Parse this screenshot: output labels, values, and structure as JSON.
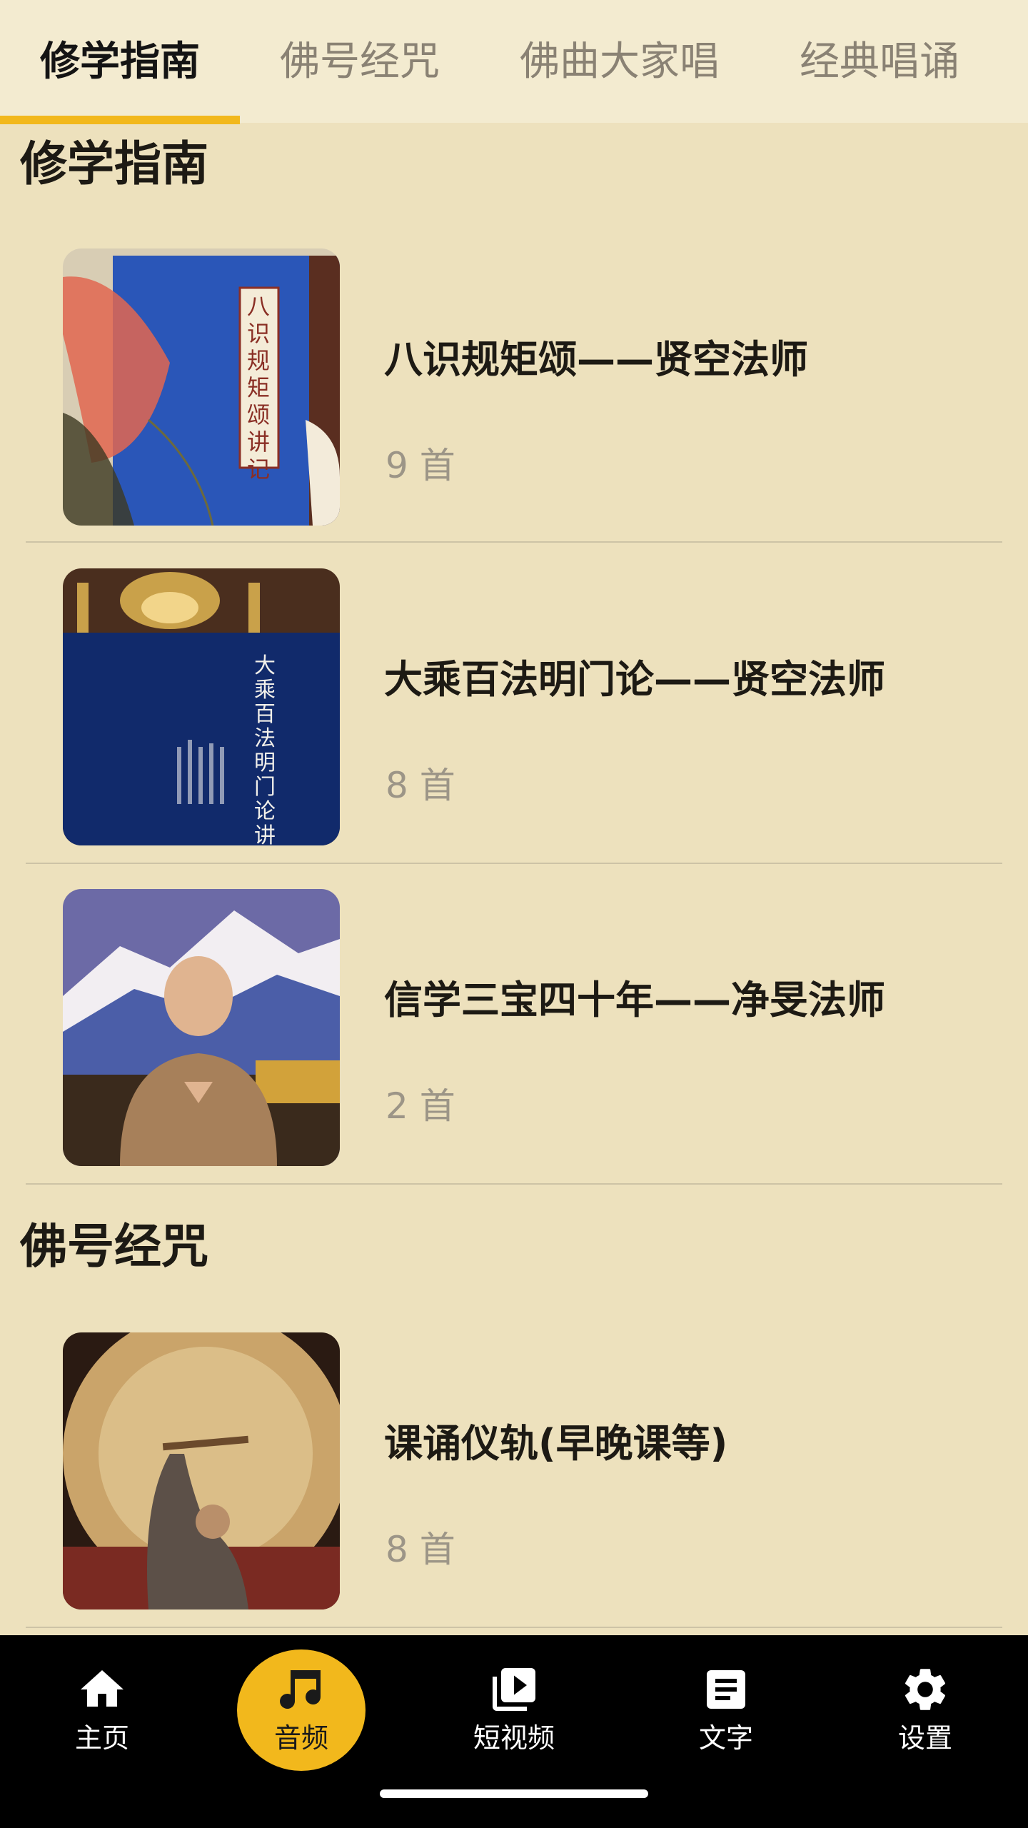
{
  "tabs": [
    {
      "label": "修学指南",
      "active": true
    },
    {
      "label": "佛号经咒",
      "active": false
    },
    {
      "label": "佛曲大家唱",
      "active": false
    },
    {
      "label": "经典唱诵",
      "active": false
    }
  ],
  "sections": [
    {
      "title": "修学指南",
      "items": [
        {
          "title": "八识规矩颂——贤空法师",
          "count": "9 首",
          "cover_text": "八识规矩颂讲记"
        },
        {
          "title": "大乘百法明门论——贤空法师",
          "count": "8 首",
          "cover_text": "大乘百法明门论讲记"
        },
        {
          "title": "信学三宝四十年——净旻法师",
          "count": "2 首"
        }
      ]
    },
    {
      "title": "佛号经咒",
      "items": [
        {
          "title": "课诵仪轨(早晚课等)",
          "count": "8 首"
        }
      ]
    }
  ],
  "bottom_nav": [
    {
      "label": "主页",
      "icon": "home-icon"
    },
    {
      "label": "音频",
      "icon": "music-note-icon",
      "active": true
    },
    {
      "label": "短视频",
      "icon": "video-library-icon"
    },
    {
      "label": "文字",
      "icon": "article-icon"
    },
    {
      "label": "设置",
      "icon": "gear-icon"
    }
  ],
  "colors": {
    "background": "#ede1bd",
    "accent": "#f2b81c",
    "nav_background": "#000000"
  }
}
